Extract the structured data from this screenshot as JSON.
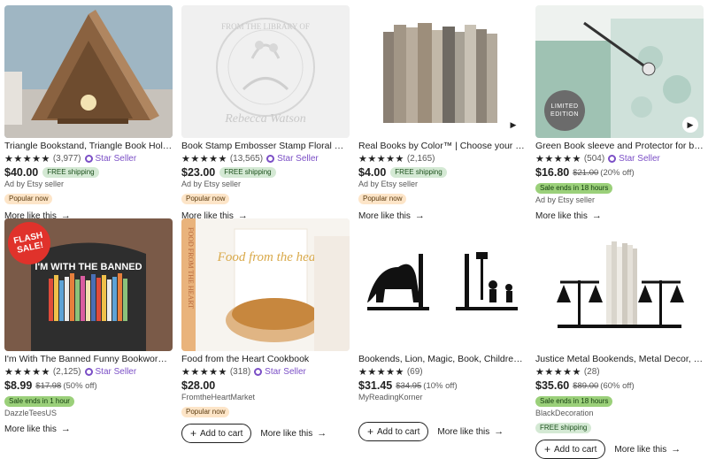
{
  "colors": {
    "accent": "#7b4fc6",
    "free_shipping_bg": "#d4e9d4",
    "sale_bg": "#9bd07a",
    "popular_bg": "#fde5c8"
  },
  "star_seller_label": "Star Seller",
  "more_like_this": "More like this",
  "add_to_cart": "Add to cart",
  "listings": [
    {
      "title": "Triangle Bookstand, Triangle Book Holder, Nigh...",
      "stars": "★★★★★",
      "reviews": "(3,977)",
      "star_seller": true,
      "price": "$40.00",
      "free_shipping": "FREE shipping",
      "ad": "Ad by Etsy seller",
      "popular": "Popular now",
      "image_icon": "triangle-bookstand-image"
    },
    {
      "title": "Book Stamp Embosser Stamp Floral Custom N...",
      "stars": "★★★★★",
      "reviews": "(13,565)",
      "star_seller": true,
      "price": "$23.00",
      "free_shipping": "FREE shipping",
      "ad": "Ad by Etsy seller",
      "popular": "Popular now",
      "image_icon": "embosser-stamp-image",
      "stamp_text_top": "FROM THE LIBRARY OF",
      "stamp_text_bottom": "Rebecca Watson"
    },
    {
      "title": "Real Books by Color™ | Choose your Colors | O...",
      "stars": "★★★★★",
      "reviews": "(2,165)",
      "star_seller": false,
      "price": "$4.00",
      "free_shipping": "FREE shipping",
      "ad": "Ad by Etsy seller",
      "popular": "Popular now",
      "image_icon": "books-by-color-image",
      "has_video": true
    },
    {
      "title": "Green Book sleeve and Protector for book, Jap...",
      "stars": "★★★★★",
      "reviews": "(504)",
      "star_seller": true,
      "price": "$16.80",
      "original_price": "$21.00",
      "discount": "(20% off)",
      "sale": "Sale ends in 18 hours",
      "ad": "Ad by Etsy seller",
      "image_icon": "book-sleeve-image",
      "limited": "LIMITED EDITION",
      "has_video": true
    },
    {
      "title": "I'm With The Banned Funny Bookworm T-Shirt, ...",
      "stars": "★★★★★",
      "reviews": "(2,125)",
      "star_seller": true,
      "price": "$8.99",
      "original_price": "$17.98",
      "discount": "(50% off)",
      "sale": "Sale ends in 1 hour",
      "shop": "DazzleTeesUS",
      "image_icon": "banned-tshirt-image",
      "flash": "FLASH SALE!",
      "shirt_text": "I'M WITH THE BANNED"
    },
    {
      "title": "Food from the Heart Cookbook",
      "stars": "★★★★★",
      "reviews": "(318)",
      "star_seller": true,
      "price": "$28.00",
      "shop": "FromtheHeartMarket",
      "popular": "Popular now",
      "image_icon": "cookbook-image",
      "cover_text": "Food from the heart",
      "spine_text": "FOOD FROM THE HEART",
      "has_cart": true
    },
    {
      "title": "Bookends, Lion, Magic, Book, Children books, ...",
      "stars": "★★★★★",
      "reviews": "(69)",
      "star_seller": false,
      "price": "$31.45",
      "original_price": "$34.95",
      "discount": "(10% off)",
      "shop": "MyReadingKorner",
      "image_icon": "lion-bookends-image",
      "has_cart": true
    },
    {
      "title": "Justice Metal Bookends, Metal Decor, Metal Art...",
      "stars": "★★★★★",
      "reviews": "(28)",
      "star_seller": false,
      "price": "$35.60",
      "original_price": "$89.00",
      "discount": "(60% off)",
      "sale": "Sale ends in 18 hours",
      "shop": "BlackDecoration",
      "free_shipping_block": "FREE shipping",
      "image_icon": "justice-bookends-image",
      "has_cart": true
    }
  ]
}
